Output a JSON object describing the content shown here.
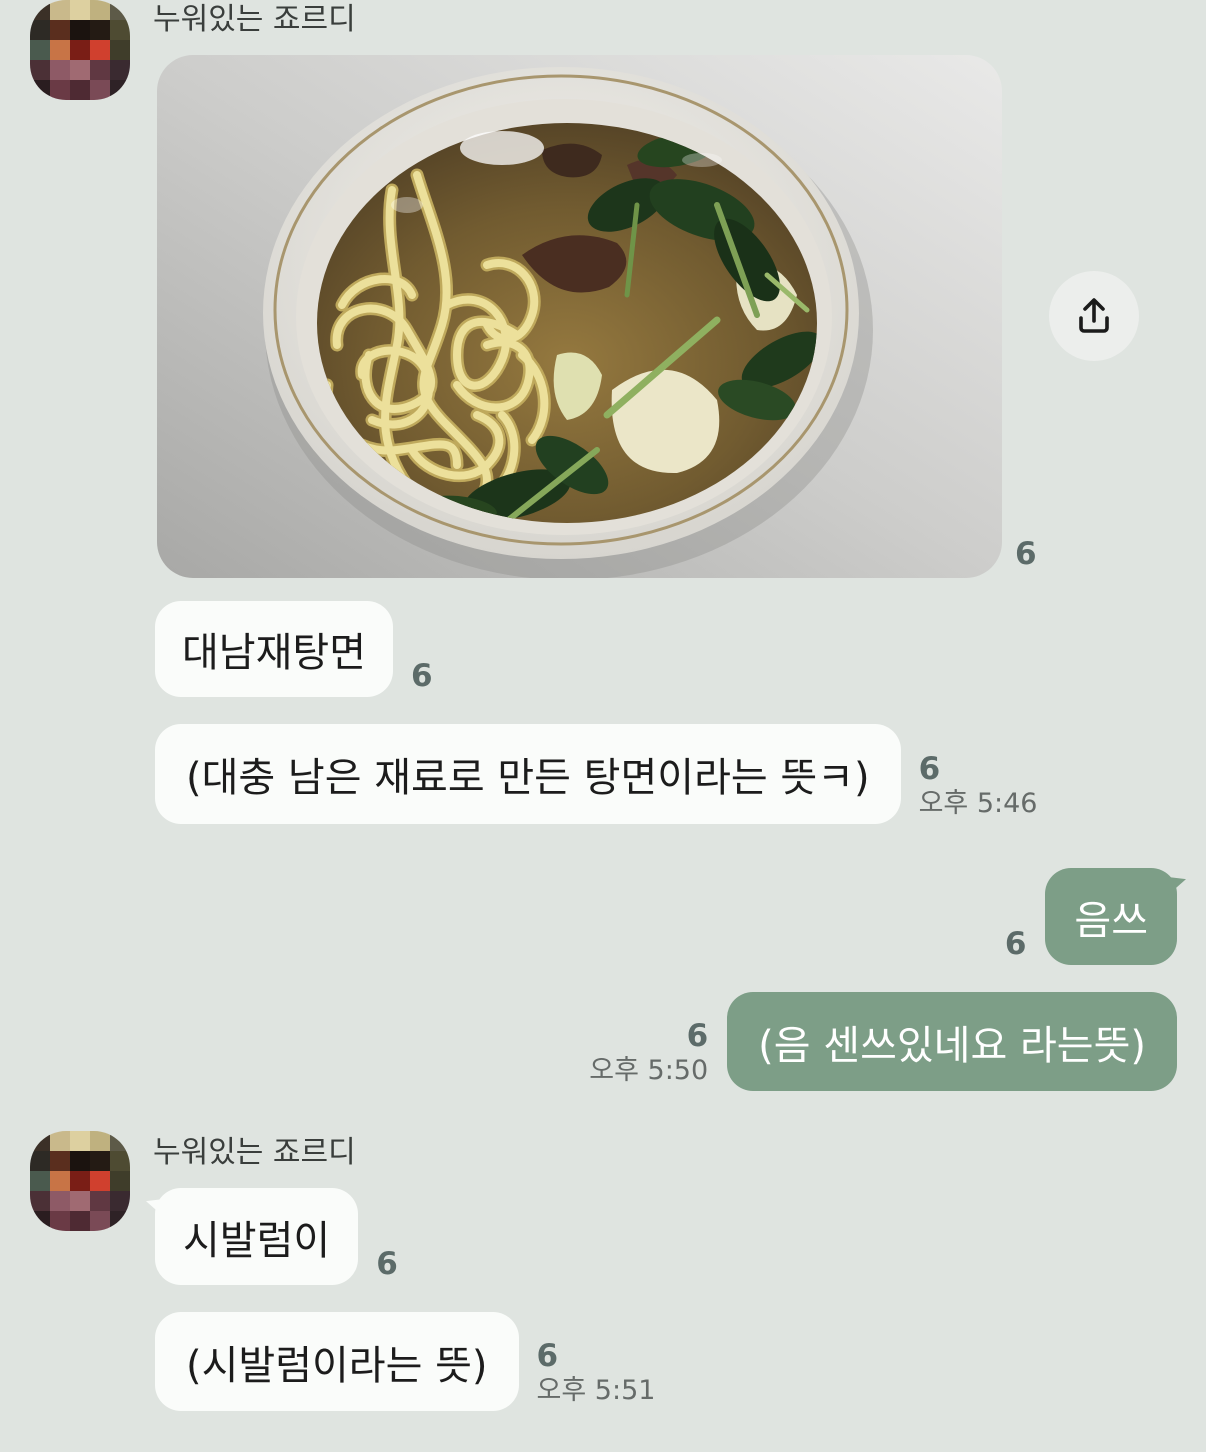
{
  "colors": {
    "background": "#dfe4e0",
    "bubble_other": "#fafcfa",
    "bubble_me": "#7d9e87",
    "unread": "#5c6b69"
  },
  "icons": {
    "share_button": "upload-icon",
    "avatar": "pixelated-avatar"
  },
  "group1": {
    "sender_name": "누워있는 죠르디",
    "photo": {
      "unread": "6"
    },
    "messages": [
      {
        "text": "대남재탕면",
        "unread": "6"
      },
      {
        "text": "(대충 남은 재료로 만든 탕면이라는 뜻ㅋ)",
        "unread": "6",
        "time": "오후 5:46"
      }
    ]
  },
  "group2": {
    "messages": [
      {
        "text": "음쓰",
        "unread": "6"
      },
      {
        "text": "(음 센쓰있네요 라는뜻)",
        "unread": "6",
        "time": "오후 5:50"
      }
    ]
  },
  "group3": {
    "sender_name": "누워있는 죠르디",
    "messages": [
      {
        "text": "시발럼이",
        "unread": "6"
      },
      {
        "text": "(시발럼이라는 뜻)",
        "unread": "6",
        "time": "오후 5:51"
      }
    ]
  }
}
